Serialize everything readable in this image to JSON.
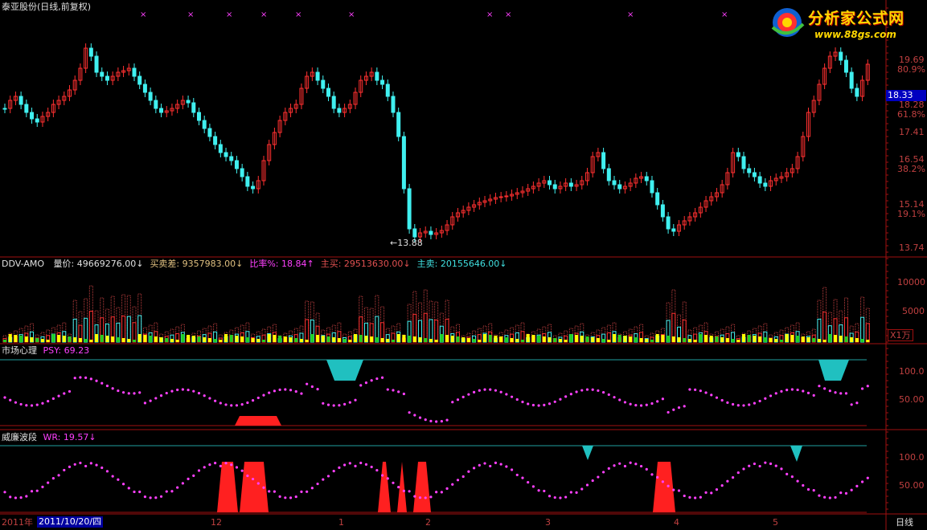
{
  "window": {
    "title": "泰亚股份(日线,前复权)"
  },
  "logo": {
    "title": "分析家公式网",
    "url": "www.88gs.com"
  },
  "main_axis": {
    "labels": [
      "19.69",
      "80.9%",
      "18.28",
      "61.8%",
      "17.41",
      "16.54",
      "38.2%",
      "15.14",
      "19.1%",
      "13.74"
    ],
    "current_price": "18.33"
  },
  "low_annotation": "←13.88",
  "volume_panel": {
    "name": "DDV-AMO",
    "items": [
      {
        "label": "量价: 49669276.00↓",
        "color": "#e0e0e0"
      },
      {
        "label": "买卖差: 9357983.00↓",
        "color": "#e0c080"
      },
      {
        "label": "比率%: 18.84↑",
        "color": "#ff40ff"
      },
      {
        "label": "主买: 29513630.00↓",
        "color": "#e05050"
      },
      {
        "label": "主卖: 20155646.00↓",
        "color": "#40e0e0"
      }
    ],
    "axis_labels": [
      "10000",
      "5000"
    ],
    "unit": "X1万"
  },
  "psy_panel": {
    "name": "市场心理",
    "value_label": "PSY: 69.23",
    "axis_labels": [
      "100.0",
      "50.00"
    ]
  },
  "wr_panel": {
    "name": "威廉波段",
    "value_label": "WR: 19.57↓",
    "axis_labels": [
      "100.0",
      "50.00"
    ]
  },
  "time_axis": {
    "year_label": "2011年",
    "cursor_date": "2011/10/20/四",
    "months": [
      "12",
      "1",
      "2",
      "3",
      "4",
      "5"
    ],
    "period": "日线"
  },
  "colors": {
    "up": "#ff3030",
    "down": "#40f0f0",
    "psy_dots": "#ff40ff",
    "frame": "#a01010",
    "band_line": "#20a0a0",
    "buy_bar": "#ffff00",
    "sell_bar": "#20d020"
  }
}
